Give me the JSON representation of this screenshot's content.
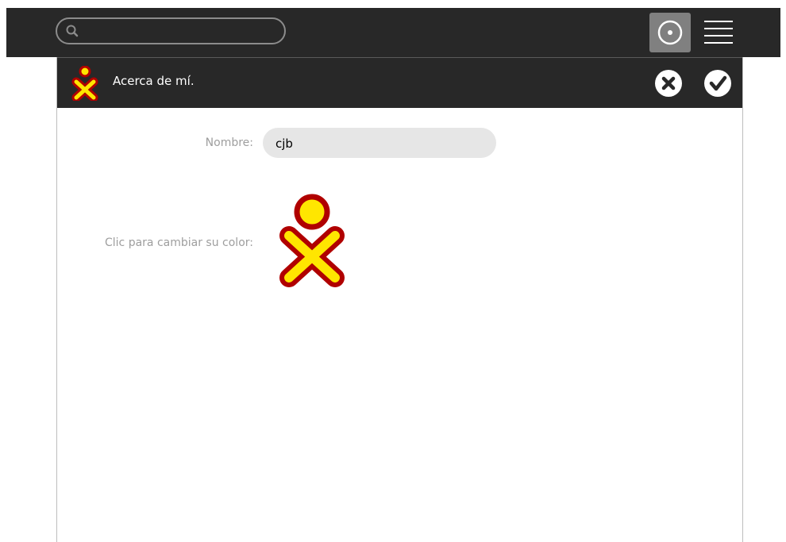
{
  "topbar": {
    "search": {
      "value": "",
      "placeholder": ""
    },
    "icons": {
      "search": "search-icon",
      "view": "neighborhood-view-icon",
      "list": "list-view-icon"
    }
  },
  "dialog": {
    "title": "Acerca de mí.",
    "cancel_icon": "cancel-icon",
    "ok_icon": "ok-icon",
    "name_label": "Nombre:",
    "name_value": "cjb",
    "color_label": "Clic para cambiar su color:",
    "xo_colors": {
      "stroke": "#b00000",
      "fill": "#ffe600"
    }
  },
  "colors": {
    "bar": "#282828",
    "view_button": "#808080",
    "label": "#9e9e9e",
    "field": "#e6e6e6"
  }
}
